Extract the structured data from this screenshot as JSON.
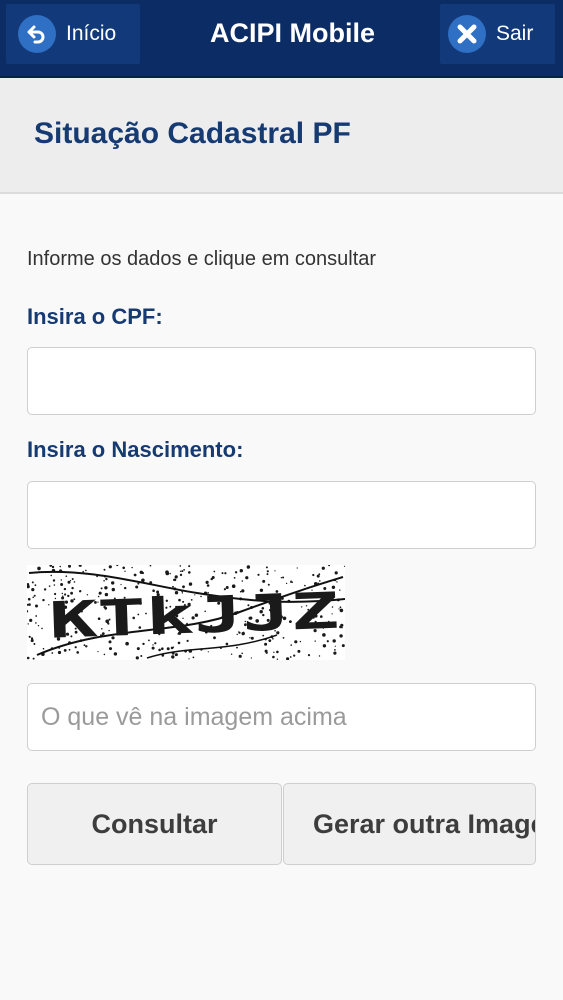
{
  "topbar": {
    "back_label": "Início",
    "title": "ACIPI Mobile",
    "exit_label": "Sair",
    "colors": {
      "bar": "#0c2c66",
      "button": "#123a7a",
      "icon_circle": "#2f6fc4"
    },
    "icons": {
      "back": "back-arrow-icon",
      "exit": "close-icon"
    }
  },
  "header": {
    "title": "Situação Cadastral PF"
  },
  "form": {
    "instructions": "Informe os dados e clique em consultar",
    "cpf_label": "Insira o CPF:",
    "cpf_value": "",
    "birth_label": "Insira o Nascimento:",
    "birth_value": "",
    "captcha_text": "KTkJJZ",
    "captcha_placeholder": "O que vê na imagem acima",
    "captcha_value": "",
    "consult_button": "Consultar",
    "regenerate_button": "Gerar outra Imagem"
  }
}
